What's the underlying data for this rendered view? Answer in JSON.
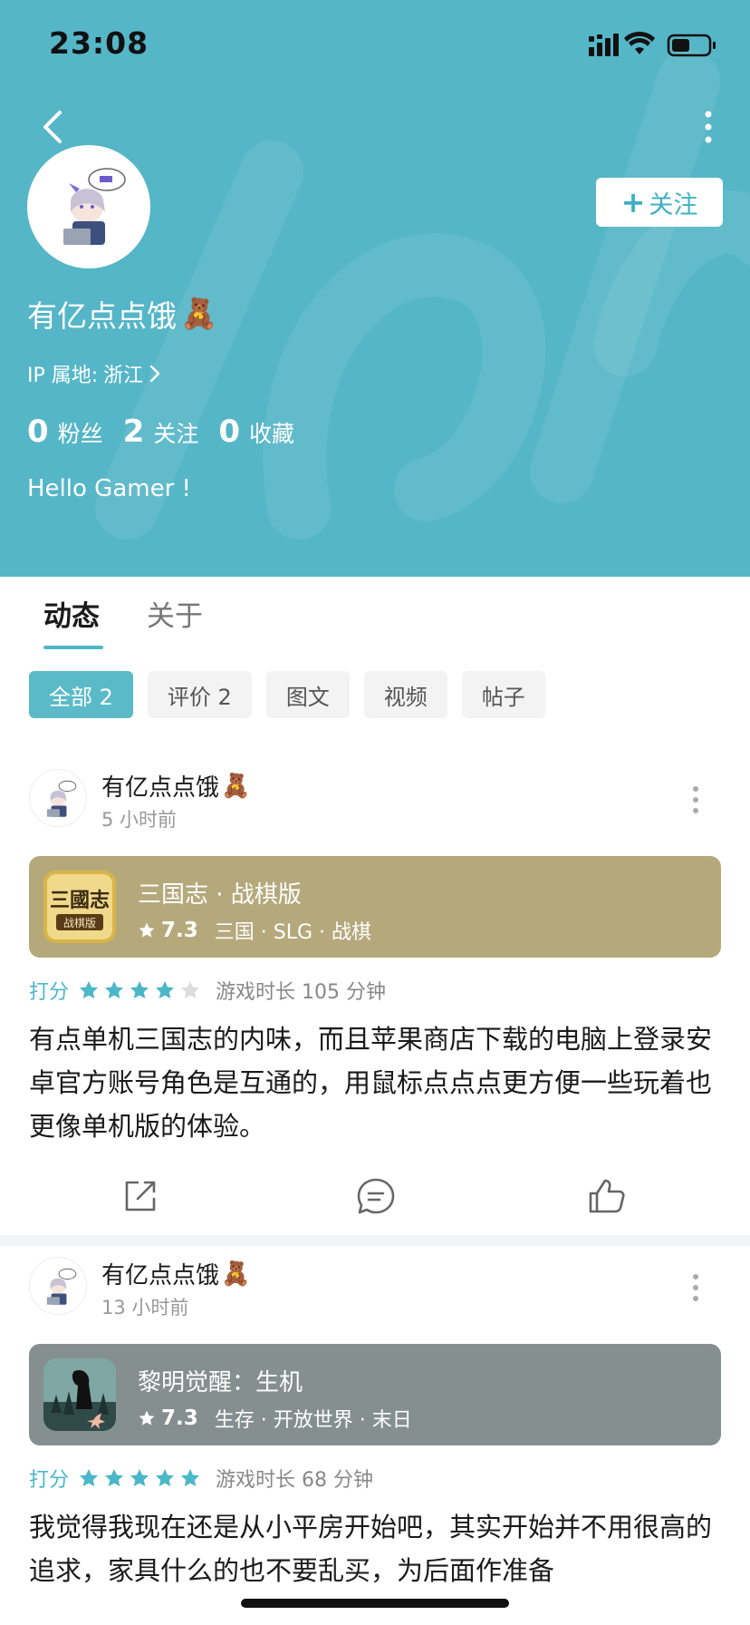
{
  "status_bar": {
    "time": "23:08"
  },
  "colors": {
    "header_bg": "#55b6c7",
    "accent": "#4cb7c8",
    "card1_bg": "#b5a97c",
    "card2_bg": "#858f8f"
  },
  "profile": {
    "username": "有亿点点饿",
    "username_emoji": "🧸",
    "follow_label": "关注",
    "ip_label": "IP 属地:",
    "ip_location": "浙江",
    "stats": [
      {
        "count": "0",
        "label": "粉丝"
      },
      {
        "count": "2",
        "label": "关注"
      },
      {
        "count": "0",
        "label": "收藏"
      }
    ],
    "bio": "Hello Gamer !"
  },
  "tabs": [
    {
      "label": "动态",
      "active": true
    },
    {
      "label": "关于",
      "active": false
    }
  ],
  "filters": [
    {
      "label": "全部 2",
      "active": true
    },
    {
      "label": "评价 2",
      "active": false
    },
    {
      "label": "图文",
      "active": false
    },
    {
      "label": "视频",
      "active": false
    },
    {
      "label": "帖子",
      "active": false
    }
  ],
  "posts": [
    {
      "author": "有亿点点饿",
      "author_emoji": "🧸",
      "time": "5 小时前",
      "game": {
        "title": "三国志 · 战棋版",
        "score": "7.3",
        "tags": "三国 · SLG · 战棋",
        "icon_text": "三國志",
        "icon_sub": "战棋版"
      },
      "rating_label": "打分",
      "stars": 4,
      "playtime": "游戏时长 105 分钟",
      "text": "有点单机三国志的内味，而且苹果商店下载的电脑上登录安卓官方账号角色是互通的，用鼠标点点点更方便一些玩着也更像单机版的体验。"
    },
    {
      "author": "有亿点点饿",
      "author_emoji": "🧸",
      "time": "13 小时前",
      "game": {
        "title": "黎明觉醒：生机",
        "score": "7.3",
        "tags": "生存 · 开放世界 · 末日"
      },
      "rating_label": "打分",
      "stars": 5,
      "playtime": "游戏时长 68 分钟",
      "text": "我觉得我现在还是从小平房开始吧，其实开始并不用很高的追求，家具什么的也不要乱买，为后面作准备"
    }
  ]
}
